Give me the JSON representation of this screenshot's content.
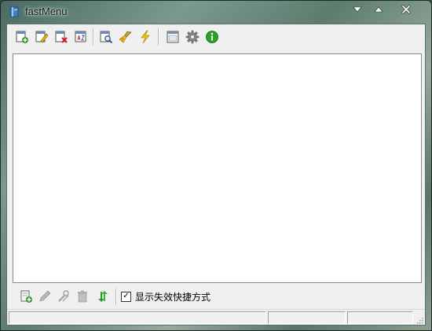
{
  "window": {
    "title": "fastMenu",
    "app_icon": "book-icon",
    "caption_buttons": [
      {
        "name": "minimize-button",
        "icon": "triangle-down-icon"
      },
      {
        "name": "maximize-button",
        "icon": "triangle-up-icon"
      },
      {
        "name": "close-button",
        "icon": "close-icon"
      }
    ]
  },
  "toolbar_top": {
    "buttons": [
      {
        "name": "add-item-button",
        "icon": "add-document-icon"
      },
      {
        "name": "edit-item-button",
        "icon": "edit-document-icon"
      },
      {
        "name": "delete-item-button",
        "icon": "delete-document-icon"
      },
      {
        "name": "sort-items-button",
        "icon": "sort-az-icon"
      },
      {
        "name": "find-button",
        "icon": "magnifier-document-icon"
      },
      {
        "name": "clean-button",
        "icon": "broom-icon"
      },
      {
        "name": "quick-run-button",
        "icon": "lightning-icon"
      },
      {
        "name": "view-button",
        "icon": "window-icon"
      },
      {
        "name": "settings-button",
        "icon": "gear-icon"
      },
      {
        "name": "about-button",
        "icon": "info-icon"
      }
    ]
  },
  "list": {
    "items": []
  },
  "toolbar_bottom": {
    "buttons": [
      {
        "name": "add-shortcut-button",
        "icon": "add-shortcut-icon"
      },
      {
        "name": "edit-shortcut-button",
        "icon": "pencil-icon"
      },
      {
        "name": "rename-shortcut-button",
        "icon": "tools-icon"
      },
      {
        "name": "delete-shortcut-button",
        "icon": "trash-icon"
      },
      {
        "name": "refresh-button",
        "icon": "refresh-icon"
      }
    ],
    "show_invalid_checkbox": {
      "label": "显示失效快捷方式",
      "checked": true,
      "check_mark": "✓"
    }
  },
  "statusbar": {
    "panels": [
      "",
      "",
      ""
    ]
  },
  "colors": {
    "accent_green": "#2d9a2d",
    "accent_red": "#d02020",
    "accent_yellow": "#e8b400",
    "info_green": "#27a12a"
  }
}
